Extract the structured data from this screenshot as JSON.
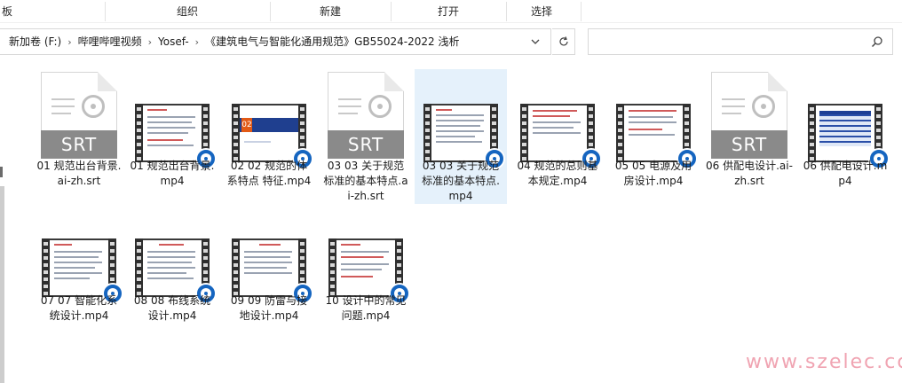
{
  "ribbon": {
    "groups": [
      "板",
      "组织",
      "新建",
      "打开",
      "选择"
    ]
  },
  "address": {
    "crumbs": [
      "新加卷 (F:)",
      "哔哩哔哩视频",
      "Yosef-",
      "《建筑电气与智能化通用规范》GB55024-2022 浅析"
    ],
    "search_placeholder": ""
  },
  "files": [
    {
      "name": "01 规范出台背景.ai-zh.srt",
      "kind": "srt",
      "selected": false
    },
    {
      "name": "01 规范出台背景.mp4",
      "kind": "video",
      "selected": false
    },
    {
      "name": "02 02 规范的体系特点 特征.mp4",
      "kind": "video",
      "selected": false
    },
    {
      "name": "03 03 关于规范标准的基本特点.ai-zh.srt",
      "kind": "srt",
      "selected": false
    },
    {
      "name": "03 03 关于规范标准的基本特点.mp4",
      "kind": "video",
      "selected": true
    },
    {
      "name": "04 规范的总则基本规定.mp4",
      "kind": "video",
      "selected": false
    },
    {
      "name": "05 05 电源及用房设计.mp4",
      "kind": "video",
      "selected": false
    },
    {
      "name": "06 供配电设计.ai-zh.srt",
      "kind": "srt",
      "selected": false
    },
    {
      "name": "06 供配电设计.mp4",
      "kind": "video",
      "selected": false
    },
    {
      "name": "07 07 智能化系统设计.mp4",
      "kind": "video",
      "selected": false
    },
    {
      "name": "08 08 布线系统设计.mp4",
      "kind": "video",
      "selected": false
    },
    {
      "name": "09 09 防雷与接地设计.mp4",
      "kind": "video",
      "selected": false
    },
    {
      "name": "10 设计中的常见问题.mp4",
      "kind": "video",
      "selected": false
    }
  ],
  "thumbnails": {
    "srt_label": "SRT",
    "slide_number": "02"
  },
  "icons": {
    "address_dropdown": "chevron-down-icon",
    "refresh": "refresh-icon",
    "search": "search-icon",
    "video_badge": "media-player-badge-icon",
    "srt_reel": "film-reel-icon"
  },
  "colors": {
    "selection": "#e5f1fb",
    "badge": "#1565c0",
    "watermark": "#f0a4b2"
  },
  "watermark": "www.szelec.cc"
}
